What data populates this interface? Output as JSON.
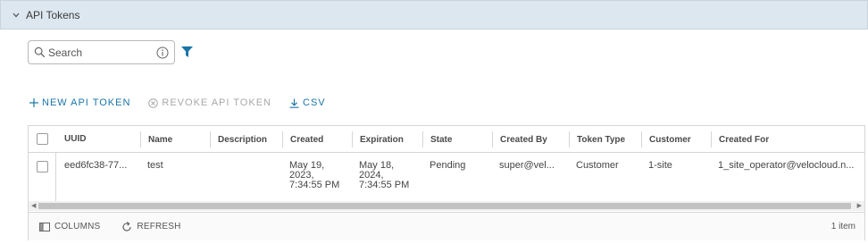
{
  "section": {
    "title": "API Tokens"
  },
  "search": {
    "placeholder": "Search"
  },
  "actions": {
    "new_token": "NEW API TOKEN",
    "revoke_token": "REVOKE API TOKEN",
    "csv": "CSV"
  },
  "table": {
    "columns": [
      "UUID",
      "Name",
      "Description",
      "Created",
      "Expiration",
      "State",
      "Created By",
      "Token Type",
      "Customer",
      "Created For"
    ],
    "rows": [
      {
        "uuid": "eed6fc38-77...",
        "name": "test",
        "description": "",
        "created": [
          "May 19,",
          "2023,",
          "7:34:55 PM"
        ],
        "expiration": [
          "May 18,",
          "2024,",
          "7:34:55 PM"
        ],
        "state": "Pending",
        "created_by": "super@vel...",
        "token_type": "Customer",
        "customer": "1-site",
        "created_for": "1_site_operator@velocloud.n..."
      }
    ]
  },
  "footer": {
    "columns_label": "COLUMNS",
    "refresh_label": "REFRESH",
    "count": "1 item"
  },
  "colors": {
    "accent": "#1b74a8",
    "header_bg": "#dde7f0",
    "disabled": "#a8a8a8"
  }
}
